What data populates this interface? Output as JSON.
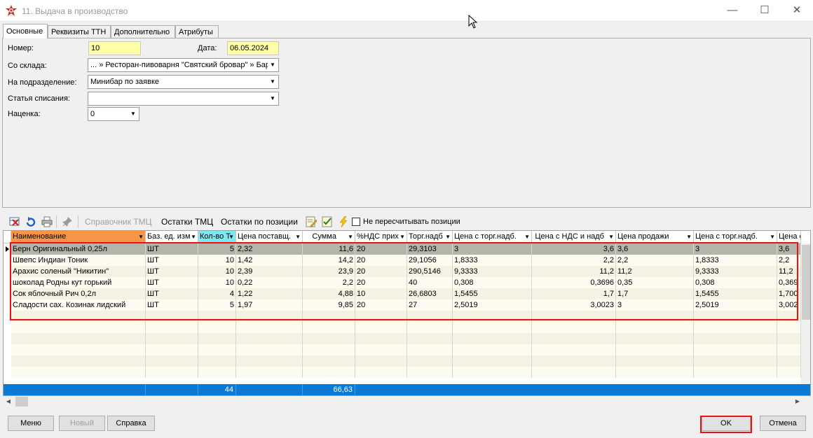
{
  "window": {
    "title": "11. Выдача в производство",
    "min": "—",
    "max": "☐",
    "close": "✕"
  },
  "tabs": [
    "Основные",
    "Реквизиты ТТН",
    "Дополнительно",
    "Атрибуты"
  ],
  "form": {
    "number_label": "Номер:",
    "number_value": "10",
    "date_label": "Дата:",
    "date_value": "06.05.2024",
    "warehouse_label": "Со склада:",
    "warehouse_value": "... » Ресторан-пивоварня \"Святский бровар\" » Бар",
    "division_label": "На подразделение:",
    "division_value": "Минибар по заявке",
    "writeoff_label": "Статья списания:",
    "writeoff_value": "",
    "markup_label": "Наценка:",
    "markup_value": "0"
  },
  "toolbar": {
    "ref_label": "Справочник ТМЦ",
    "stock_label": "Остатки ТМЦ",
    "stock_pos_label": "Остатки по позиции",
    "no_recalc_label": "Не пересчитывать позиции"
  },
  "grid": {
    "headers": [
      "Наименование",
      "Баз. ед. изм",
      "Кол-во Т",
      "Цена поставщ.",
      "Сумма",
      "%НДС прих",
      "Торг.надб",
      "Цена с торг.надб.",
      "Цена с НДС и надб",
      "Цена продажи",
      "Цена с торг.надб.",
      "Цена с"
    ],
    "rows": [
      [
        "Берн Оригинальный 0,25л",
        "ШТ",
        "5",
        "2,32",
        "11,6",
        "20",
        "29,3103",
        "3",
        "3,6",
        "3,6",
        "3",
        "3,6"
      ],
      [
        "Швепс Индиан Тоник",
        "ШТ",
        "10",
        "1,42",
        "14,2",
        "20",
        "29,1056",
        "1,8333",
        "2,2",
        "2,2",
        "1,8333",
        "2,2"
      ],
      [
        "Арахис соленый \"Никитин\"",
        "ШТ",
        "10",
        "2,39",
        "23,9",
        "20",
        "290,5146",
        "9,3333",
        "11,2",
        "11,2",
        "9,3333",
        "11,2"
      ],
      [
        "шоколад Родны кут горький",
        "ШТ",
        "10",
        "0,22",
        "2,2",
        "20",
        "40",
        "0,308",
        "0,3696",
        "0,35",
        "0,308",
        "0,369"
      ],
      [
        "Сок яблочный Рич  0,2л",
        "ШТ",
        "4",
        "1,22",
        "4,88",
        "10",
        "26,6803",
        "1,5455",
        "1,7",
        "1,7",
        "1,5455",
        "1,700"
      ],
      [
        "Сладости сах. Козинак лидский",
        "ШТ",
        "5",
        "1,97",
        "9,85",
        "20",
        "27",
        "2,5019",
        "3,0023",
        "3",
        "2,5019",
        "3,002"
      ]
    ],
    "total_qty": "44",
    "total_sum": "66,63"
  },
  "buttons": {
    "menu": "Меню",
    "new": "Новый",
    "help": "Справка",
    "ok": "OK",
    "cancel": "Отмена"
  },
  "colors": {
    "sort_header": "#f79646",
    "active_header": "#7ee7f0",
    "footer": "#0a7ad4",
    "highlight": "#e11111"
  }
}
